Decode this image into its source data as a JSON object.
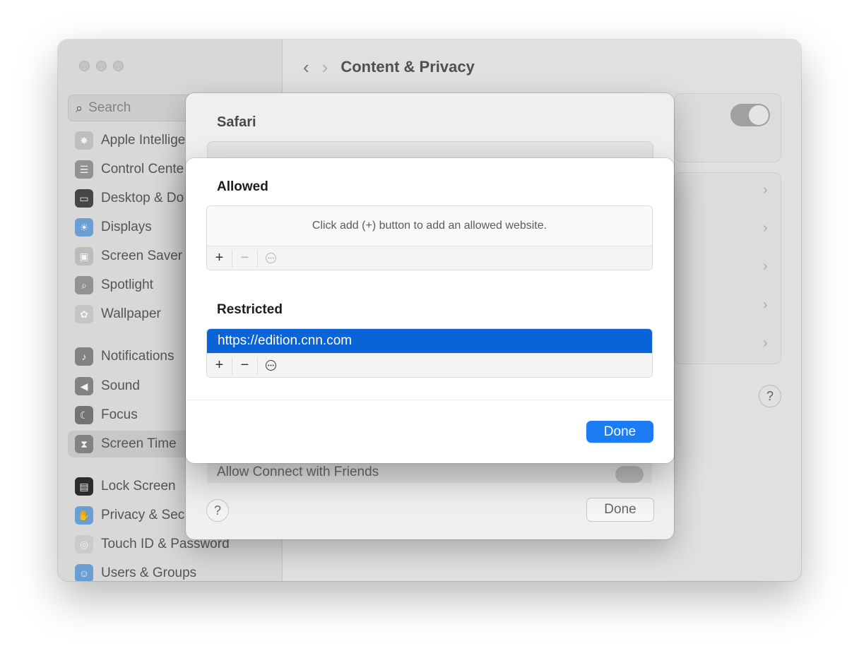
{
  "sidebar": {
    "search_placeholder": "Search",
    "items": [
      {
        "label": "Apple Intellige",
        "icon": "apple-intelligence-icon",
        "color": "#c9c9c9"
      },
      {
        "label": "Control Cente",
        "icon": "control-center-icon",
        "color": "#9a9a9a"
      },
      {
        "label": "Desktop & Do",
        "icon": "desktop-dock-icon",
        "color": "#4a4a4a"
      },
      {
        "label": "Displays",
        "icon": "displays-icon",
        "color": "#6fa8e0"
      },
      {
        "label": "Screen Saver",
        "icon": "screen-saver-icon",
        "color": "#c7c7c7"
      },
      {
        "label": "Spotlight",
        "icon": "spotlight-icon",
        "color": "#9a9a9a"
      },
      {
        "label": "Wallpaper",
        "icon": "wallpaper-icon",
        "color": "#d0d0d0"
      },
      {
        "label": "Notifications",
        "icon": "notifications-icon",
        "color": "#8a8a8a"
      },
      {
        "label": "Sound",
        "icon": "sound-icon",
        "color": "#8a8a8a"
      },
      {
        "label": "Focus",
        "icon": "focus-icon",
        "color": "#7a7a7a"
      },
      {
        "label": "Screen Time",
        "icon": "screen-time-icon",
        "color": "#8a8a8a",
        "selected": true
      },
      {
        "label": "Lock Screen",
        "icon": "lock-screen-icon",
        "color": "#2f2f2f"
      },
      {
        "label": "Privacy & Sec",
        "icon": "privacy-hand-icon",
        "color": "#6fa8e0"
      },
      {
        "label": "Touch ID & Password",
        "icon": "touch-id-icon",
        "color": "#d6d6d6"
      },
      {
        "label": "Users & Groups",
        "icon": "users-groups-icon",
        "color": "#6fa8e0"
      }
    ]
  },
  "main": {
    "title": "Content & Privacy",
    "help_label": "?"
  },
  "safari_sheet": {
    "title": "Safari",
    "partial_row_label": "Allow Connect with Friends",
    "help_label": "?",
    "done_label": "Done"
  },
  "dialog": {
    "allowed_title": "Allowed",
    "allowed_empty_hint": "Click add (+) button to add an allowed website.",
    "restricted_title": "Restricted",
    "restricted_items": [
      "https://edition.cnn.com"
    ],
    "add_label": "+",
    "remove_label": "−",
    "done_label": "Done"
  },
  "colors": {
    "accent": "#1c7cf4",
    "selection": "#0a64d8"
  }
}
